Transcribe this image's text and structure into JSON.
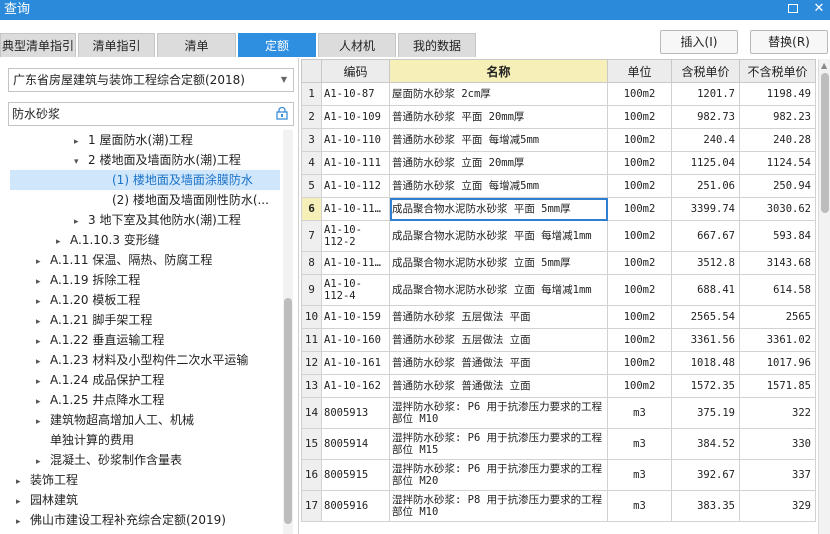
{
  "window": {
    "title": "查询"
  },
  "tabs": [
    {
      "label": "典型清单指引",
      "active": false
    },
    {
      "label": "清单指引",
      "active": false
    },
    {
      "label": "清单",
      "active": false
    },
    {
      "label": "定额",
      "active": true
    },
    {
      "label": "人材机",
      "active": false
    },
    {
      "label": "我的数据",
      "active": false
    }
  ],
  "actions": {
    "insert": "插入(I)",
    "replace": "替换(R)"
  },
  "library_select": {
    "value": "广东省房屋建筑与装饰工程综合定额(2018)"
  },
  "search": {
    "value": "防水砂浆"
  },
  "tree": [
    {
      "label": "1 屋面防水(潮)工程",
      "toggle": "▸"
    },
    {
      "label": "2 楼地面及墙面防水(潮)工程",
      "toggle": "▾"
    },
    {
      "label": "(1) 楼地面及墙面涂膜防水",
      "toggle": ""
    },
    {
      "label": "(2) 楼地面及墙面刚性防水(...",
      "toggle": ""
    },
    {
      "label": "3 地下室及其他防水(潮)工程",
      "toggle": "▸"
    },
    {
      "label": "A.1.10.3 变形缝",
      "toggle": "▸"
    },
    {
      "label": "A.1.11 保温、隔热、防腐工程",
      "toggle": "▸"
    },
    {
      "label": "A.1.19 拆除工程",
      "toggle": "▸"
    },
    {
      "label": "A.1.20 模板工程",
      "toggle": "▸"
    },
    {
      "label": "A.1.21 脚手架工程",
      "toggle": "▸"
    },
    {
      "label": "A.1.22 垂直运输工程",
      "toggle": "▸"
    },
    {
      "label": "A.1.23 材料及小型构件二次水平运输",
      "toggle": "▸"
    },
    {
      "label": "A.1.24 成品保护工程",
      "toggle": "▸"
    },
    {
      "label": "A.1.25 井点降水工程",
      "toggle": "▸"
    },
    {
      "label": "建筑物超高增加人工、机械",
      "toggle": "▸"
    },
    {
      "label": "单独计算的费用",
      "toggle": ""
    },
    {
      "label": "混凝土、砂浆制作含量表",
      "toggle": "▸"
    },
    {
      "label": "装饰工程",
      "toggle": "▸"
    },
    {
      "label": "园林建筑",
      "toggle": "▸"
    },
    {
      "label": "佛山市建设工程补充综合定额(2019)",
      "toggle": "▸"
    }
  ],
  "table": {
    "headers": [
      "",
      "编码",
      "名称",
      "单位",
      "含税单价",
      "不含税单价"
    ],
    "rows": [
      {
        "n": "1",
        "code": "A1-10-87",
        "name": "屋面防水砂浆 2cm厚",
        "unit": "100m2",
        "tax": "1201.7",
        "notax": "1198.49"
      },
      {
        "n": "2",
        "code": "A1-10-109",
        "name": "普通防水砂浆 平面 20mm厚",
        "unit": "100m2",
        "tax": "982.73",
        "notax": "982.23"
      },
      {
        "n": "3",
        "code": "A1-10-110",
        "name": "普通防水砂浆 平面 每增减5mm",
        "unit": "100m2",
        "tax": "240.4",
        "notax": "240.28"
      },
      {
        "n": "4",
        "code": "A1-10-111",
        "name": "普通防水砂浆 立面 20mm厚",
        "unit": "100m2",
        "tax": "1125.04",
        "notax": "1124.54"
      },
      {
        "n": "5",
        "code": "A1-10-112",
        "name": "普通防水砂浆 立面 每增减5mm",
        "unit": "100m2",
        "tax": "251.06",
        "notax": "250.94"
      },
      {
        "n": "6",
        "code": "A1-10-11…",
        "name": "成品聚合物水泥防水砂浆 平面 5mm厚",
        "unit": "100m2",
        "tax": "3399.74",
        "notax": "3030.62"
      },
      {
        "n": "7",
        "code": "A1-10-112-2",
        "name": "成品聚合物水泥防水砂浆 平面 每增减1mm",
        "unit": "100m2",
        "tax": "667.67",
        "notax": "593.84"
      },
      {
        "n": "8",
        "code": "A1-10-11…",
        "name": "成品聚合物水泥防水砂浆 立面 5mm厚",
        "unit": "100m2",
        "tax": "3512.8",
        "notax": "3143.68"
      },
      {
        "n": "9",
        "code": "A1-10-112-4",
        "name": "成品聚合物水泥防水砂浆 立面 每增减1mm",
        "unit": "100m2",
        "tax": "688.41",
        "notax": "614.58"
      },
      {
        "n": "10",
        "code": "A1-10-159",
        "name": "普通防水砂浆 五层做法 平面",
        "unit": "100m2",
        "tax": "2565.54",
        "notax": "2565"
      },
      {
        "n": "11",
        "code": "A1-10-160",
        "name": "普通防水砂浆 五层做法 立面",
        "unit": "100m2",
        "tax": "3361.56",
        "notax": "3361.02"
      },
      {
        "n": "12",
        "code": "A1-10-161",
        "name": "普通防水砂浆 普通做法 平面",
        "unit": "100m2",
        "tax": "1018.48",
        "notax": "1017.96"
      },
      {
        "n": "13",
        "code": "A1-10-162",
        "name": "普通防水砂浆 普通做法 立面",
        "unit": "100m2",
        "tax": "1572.35",
        "notax": "1571.85"
      },
      {
        "n": "14",
        "code": "8005913",
        "name": "湿拌防水砂浆: P6 用于抗渗压力要求的工程部位 M10",
        "unit": "m3",
        "tax": "375.19",
        "notax": "322"
      },
      {
        "n": "15",
        "code": "8005914",
        "name": "湿拌防水砂浆: P6 用于抗渗压力要求的工程部位 M15",
        "unit": "m3",
        "tax": "384.52",
        "notax": "330"
      },
      {
        "n": "16",
        "code": "8005915",
        "name": "湿拌防水砂浆: P6 用于抗渗压力要求的工程部位 M20",
        "unit": "m3",
        "tax": "392.67",
        "notax": "337"
      },
      {
        "n": "17",
        "code": "8005916",
        "name": "湿拌防水砂浆: P8 用于抗渗压力要求的工程部位 M10",
        "unit": "m3",
        "tax": "383.35",
        "notax": "329"
      }
    ]
  }
}
